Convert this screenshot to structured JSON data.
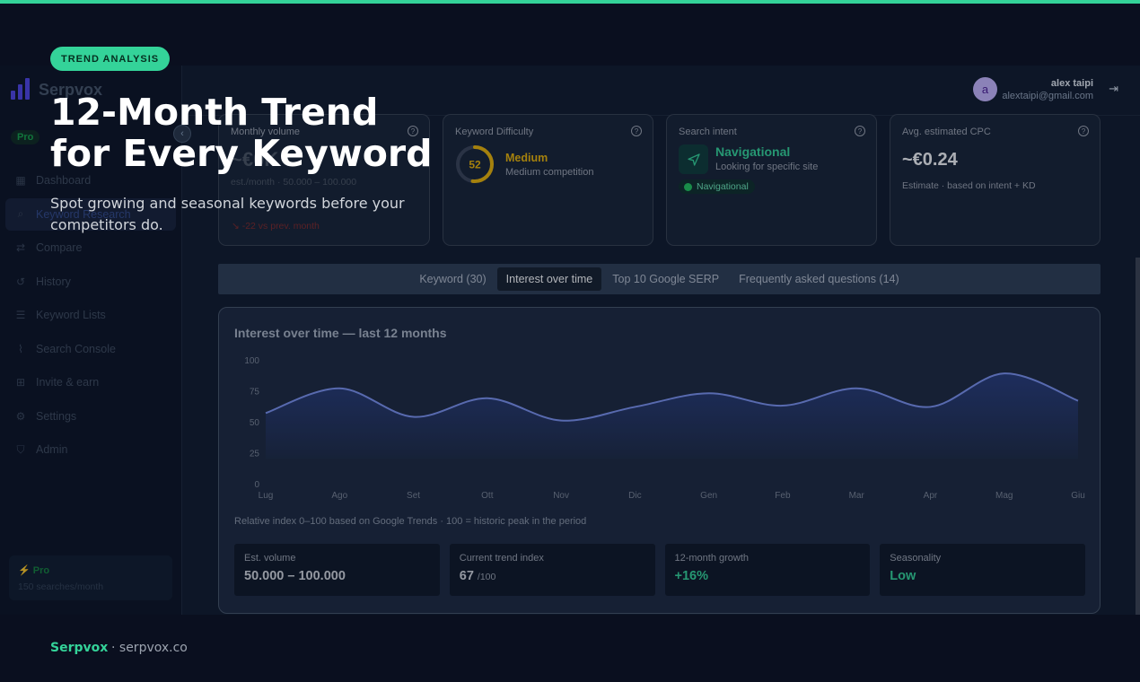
{
  "promo": {
    "badge": "TREND ANALYSIS",
    "headline_line1": "12-Month Trend",
    "headline_line2": "for Every Keyword",
    "subheadline": "Spot growing and seasonal keywords before your competitors do.",
    "footer_brand": "Serpvox",
    "footer_url": "· serpvox.co"
  },
  "app": {
    "logo_text": "Serpvox",
    "plan_pill": "Pro",
    "nav": [
      {
        "label": "Dashboard",
        "icon": "grid-icon",
        "glyph": "▦"
      },
      {
        "label": "Keyword Research",
        "icon": "search-icon",
        "glyph": "⌕"
      },
      {
        "label": "Compare",
        "icon": "compare-icon",
        "glyph": "⇄"
      },
      {
        "label": "History",
        "icon": "history-icon",
        "glyph": "↺"
      },
      {
        "label": "Keyword Lists",
        "icon": "list-icon",
        "glyph": "☰"
      },
      {
        "label": "Search Console",
        "icon": "chart-icon",
        "glyph": "⌇"
      },
      {
        "label": "Invite & earn",
        "icon": "gift-icon",
        "glyph": "⊞"
      },
      {
        "label": "Settings",
        "icon": "gear-icon",
        "glyph": "⚙"
      },
      {
        "label": "Admin",
        "icon": "shield-icon",
        "glyph": "⛉"
      }
    ],
    "pro_card": {
      "title": "Pro",
      "subtitle": "150 searches/month"
    },
    "user": {
      "initial": "a",
      "name": "alex taipi",
      "email": "alextaipi@gmail.com"
    }
  },
  "cards": {
    "monthly_volume": {
      "title": "Monthly volume",
      "value": "~€0K",
      "sub": "est./month · 50.000 – 100.000",
      "delta": "↘ -22 vs prev. month"
    },
    "difficulty": {
      "title": "Keyword Difficulty",
      "score": "52",
      "score_value": 52,
      "label": "Medium",
      "sub": "Medium competition"
    },
    "intent": {
      "title": "Search intent",
      "label": "Navigational",
      "sub": "Looking for specific site",
      "badge": "Navigational"
    },
    "cpc": {
      "title": "Avg. estimated CPC",
      "value": "~€0.24",
      "sub": "Estimate · based on intent + KD"
    }
  },
  "tabs": [
    {
      "label": "Keyword (30)",
      "active": false
    },
    {
      "label": "Interest over time",
      "active": true
    },
    {
      "label": "Top 10 Google SERP",
      "active": false
    },
    {
      "label": "Frequently asked questions (14)",
      "active": false
    }
  ],
  "chart_data": {
    "type": "area",
    "title": "Interest over time — last 12 months",
    "categories": [
      "Lug",
      "Ago",
      "Set",
      "Ott",
      "Nov",
      "Dic",
      "Gen",
      "Feb",
      "Mar",
      "Apr",
      "Mag",
      "Giu"
    ],
    "values": [
      57,
      77,
      54,
      69,
      51,
      62,
      73,
      63,
      77,
      62,
      89,
      67
    ],
    "ylim": [
      0,
      100
    ],
    "yticks": [
      0,
      25,
      50,
      75,
      100
    ],
    "xlabel": "",
    "ylabel": "",
    "line_color": "#7c93f0",
    "note": "Relative index 0–100 based on Google Trends · 100 = historic peak in the period"
  },
  "stats": [
    {
      "label": "Est. volume",
      "value": "50.000 – 100.000",
      "unit": ""
    },
    {
      "label": "Current trend index",
      "value": "67",
      "unit": "/100"
    },
    {
      "label": "12-month growth",
      "value": "+16%",
      "unit": ""
    },
    {
      "label": "Seasonality",
      "value": "Low",
      "unit": ""
    }
  ],
  "colors": {
    "accent": "#34d399",
    "warning": "#eab308",
    "line": "#7c93f0"
  }
}
